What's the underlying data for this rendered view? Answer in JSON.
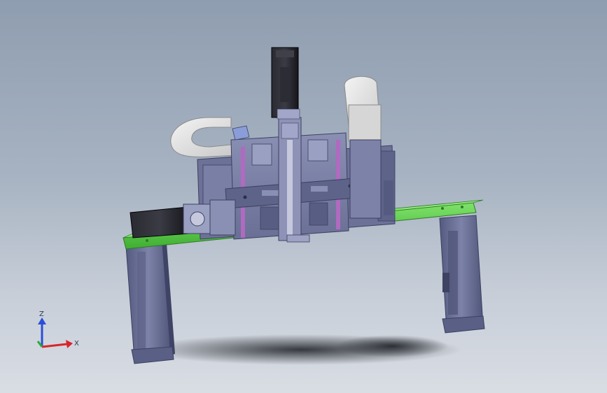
{
  "viewport": {
    "background_top": "#8f9db0",
    "background_bottom": "#d9dde4"
  },
  "model": {
    "frame_color": "#6e739a",
    "frame_dark": "#4a4e6e",
    "beam_color": "#5fd24a",
    "plate_color": "#7b80a6",
    "carriage_color": "#5b5f86",
    "cable_chain_color": "#e8e8e8",
    "motor_color": "#1e1e24"
  },
  "triad": {
    "z_label": "Z",
    "x_label": "X",
    "z_color": "#2a4fd8",
    "x_color": "#d8262a",
    "y_color": "#2aa83a"
  }
}
